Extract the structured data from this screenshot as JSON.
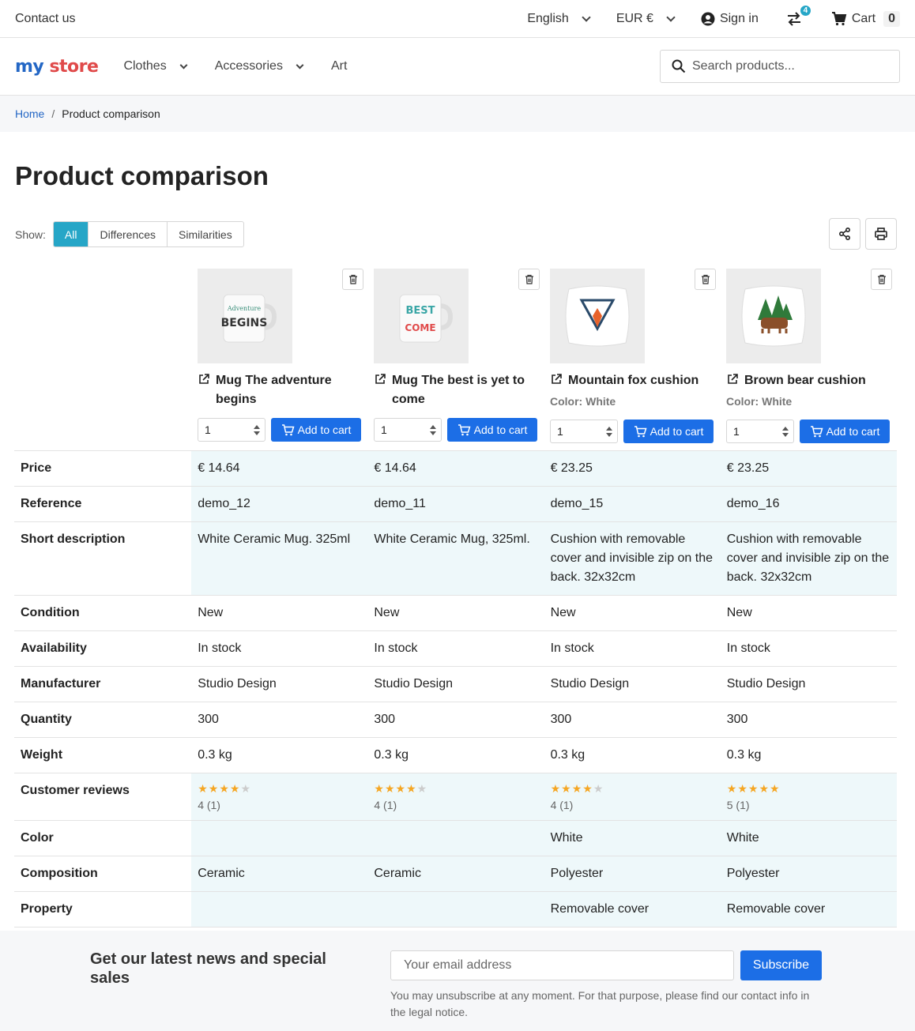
{
  "topbar": {
    "contact": "Contact us",
    "language": "English",
    "currency": "EUR €",
    "sign_in": "Sign in",
    "compare_count": "4",
    "cart_label": "Cart",
    "cart_count": "0"
  },
  "header": {
    "logo_my": "my",
    "logo_store": "store",
    "nav": [
      "Clothes",
      "Accessories",
      "Art"
    ],
    "search_placeholder": "Search products..."
  },
  "breadcrumb": {
    "home": "Home",
    "current": "Product comparison"
  },
  "page_title": "Product comparison",
  "filter": {
    "label": "Show:",
    "options": [
      "All",
      "Differences",
      "Similarities"
    ],
    "active": "All"
  },
  "products": [
    {
      "name": "Mug The adventure begins",
      "variant": "",
      "qty": "1",
      "add_label": "Add to cart"
    },
    {
      "name": "Mug The best is yet to come",
      "variant": "",
      "qty": "1",
      "add_label": "Add to cart"
    },
    {
      "name": "Mountain fox cushion",
      "variant": "Color: White",
      "qty": "1",
      "add_label": "Add to cart"
    },
    {
      "name": "Brown bear cushion",
      "variant": "Color: White",
      "qty": "1",
      "add_label": "Add to cart"
    }
  ],
  "rows": [
    {
      "label": "Price",
      "diff": true,
      "values": [
        "€ 14.64",
        "€ 14.64",
        "€ 23.25",
        "€ 23.25"
      ]
    },
    {
      "label": "Reference",
      "diff": true,
      "values": [
        "demo_12",
        "demo_11",
        "demo_15",
        "demo_16"
      ]
    },
    {
      "label": "Short description",
      "diff": true,
      "values": [
        "White Ceramic Mug. 325ml",
        "White Ceramic Mug, 325ml.",
        "Cushion with removable cover and invisible zip on the back. 32x32cm",
        "Cushion with removable cover and invisible zip on the back. 32x32cm"
      ]
    },
    {
      "label": "Condition",
      "diff": false,
      "values": [
        "New",
        "New",
        "New",
        "New"
      ]
    },
    {
      "label": "Availability",
      "diff": false,
      "values": [
        "In stock",
        "In stock",
        "In stock",
        "In stock"
      ]
    },
    {
      "label": "Manufacturer",
      "diff": false,
      "values": [
        "Studio Design",
        "Studio Design",
        "Studio Design",
        "Studio Design"
      ]
    },
    {
      "label": "Quantity",
      "diff": false,
      "values": [
        "300",
        "300",
        "300",
        "300"
      ]
    },
    {
      "label": "Weight",
      "diff": false,
      "values": [
        "0.3 kg",
        "0.3 kg",
        "0.3 kg",
        "0.3 kg"
      ]
    },
    {
      "label": "Customer reviews",
      "diff": true,
      "reviews": [
        {
          "stars": 4,
          "count": "4 (1)"
        },
        {
          "stars": 4,
          "count": "4 (1)"
        },
        {
          "stars": 4,
          "count": "4 (1)"
        },
        {
          "stars": 5,
          "count": "5 (1)"
        }
      ]
    },
    {
      "label": "Color",
      "diff": true,
      "values": [
        "",
        "",
        "White",
        "White"
      ]
    },
    {
      "label": "Composition",
      "diff": true,
      "values": [
        "Ceramic",
        "Ceramic",
        "Polyester",
        "Polyester"
      ]
    },
    {
      "label": "Property",
      "diff": true,
      "values": [
        "",
        "",
        "Removable cover",
        "Removable cover"
      ]
    }
  ],
  "newsletter": {
    "title": "Get our latest news and special sales",
    "placeholder": "Your email address",
    "button": "Subscribe",
    "note": "You may unsubscribe at any moment. For that purpose, please find our contact info in the legal notice."
  },
  "colors": {
    "accent": "#26a6c7",
    "primary": "#1c6ee6",
    "diff_bg": "#eef8fa"
  }
}
